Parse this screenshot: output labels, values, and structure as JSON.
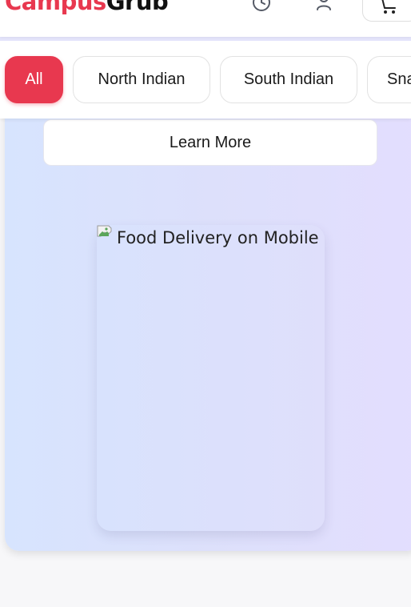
{
  "header": {
    "logo_part1": "Campus",
    "logo_part2": "Grub",
    "icons": [
      "clock-icon",
      "user-icon",
      "cart-icon"
    ]
  },
  "categories": [
    {
      "label": "All",
      "active": true
    },
    {
      "label": "North Indian",
      "active": false
    },
    {
      "label": "South Indian",
      "active": false
    },
    {
      "label": "Sna",
      "active": false
    }
  ],
  "hero": {
    "learn_more_label": "Learn More",
    "image_alt": "Food Delivery on Mobile"
  },
  "colors": {
    "brand": "#e8384f",
    "text": "#1a1a1a",
    "hero_gradient_start": "#d7e4fe",
    "hero_gradient_end": "#e3defe"
  }
}
